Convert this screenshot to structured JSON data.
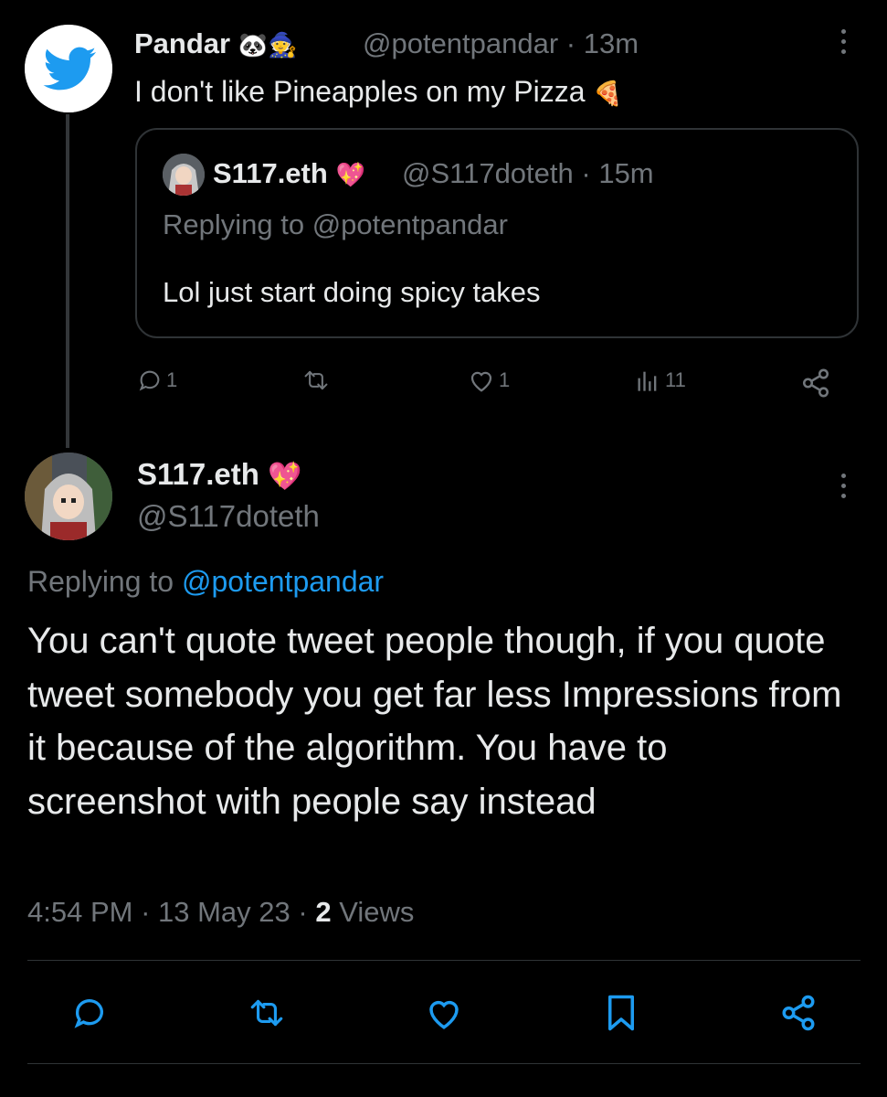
{
  "quoted_tweet": {
    "author_name": "Pandar",
    "author_emojis": [
      "🐼",
      "🧙"
    ],
    "handle": "@potentpandar",
    "time": "13m",
    "text": "I don't like Pineapples on my Pizza",
    "text_emoji": "🍕",
    "inner_reply": {
      "author_name": "S117.eth",
      "author_emoji": "💖",
      "handle": "@S117doteth",
      "time": "15m",
      "replying_label": "Replying to @potentpandar",
      "text": "Lol just start doing spicy takes"
    },
    "actions": {
      "replies": "1",
      "likes": "1",
      "views": "11"
    }
  },
  "main_tweet": {
    "author_name": "S117.eth",
    "author_emoji": "💖",
    "handle": "@S117doteth",
    "replying_prefix": "Replying to",
    "replying_handle": "@potentpandar",
    "text": "You can't quote tweet people though, if you quote tweet somebody you get far less Impressions from it because of the algorithm. You have to screenshot with people say instead",
    "time": "4:54 PM",
    "date": "13 May 23",
    "views_count": "2",
    "views_label": "Views"
  },
  "colors": {
    "background": "#000000",
    "text": "#e7e9ea",
    "muted": "#71767b",
    "link": "#1d9bf0",
    "border": "#2f3336"
  }
}
